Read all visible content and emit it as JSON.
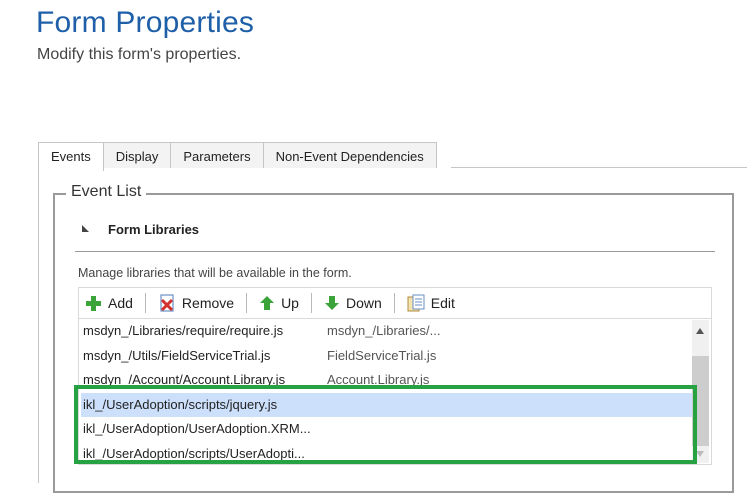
{
  "page": {
    "title": "Form Properties",
    "subtitle": "Modify this form's properties."
  },
  "tabs": [
    {
      "label": "Events",
      "active": true
    },
    {
      "label": "Display",
      "active": false
    },
    {
      "label": "Parameters",
      "active": false
    },
    {
      "label": "Non-Event Dependencies",
      "active": false
    }
  ],
  "event_list": {
    "legend": "Event List",
    "section_title": "Form Libraries",
    "description": "Manage libraries that will be available in the form."
  },
  "toolbar": {
    "add_label": "Add",
    "remove_label": "Remove",
    "up_label": "Up",
    "down_label": "Down",
    "edit_label": "Edit"
  },
  "libraries": [
    {
      "name": "msdyn_/Libraries/require/require.js",
      "display": "msdyn_/Libraries/...",
      "selected": false
    },
    {
      "name": "msdyn_/Utils/FieldServiceTrial.js",
      "display": "FieldServiceTrial.js",
      "selected": false
    },
    {
      "name": "msdyn_/Account/Account.Library.js",
      "display": "Account.Library.js",
      "selected": false
    },
    {
      "name": "ikl_/UserAdoption/scripts/jquery.js",
      "display": "",
      "selected": true
    },
    {
      "name": "ikl_/UserAdoption/UserAdoption.XRM...",
      "display": "",
      "selected": false
    },
    {
      "name": "ikl_/UserAdoption/scripts/UserAdopti...",
      "display": "",
      "selected": false
    }
  ],
  "colors": {
    "title": "#1f5fa8",
    "selection": "#cce0fb",
    "highlight": "#27a243"
  }
}
